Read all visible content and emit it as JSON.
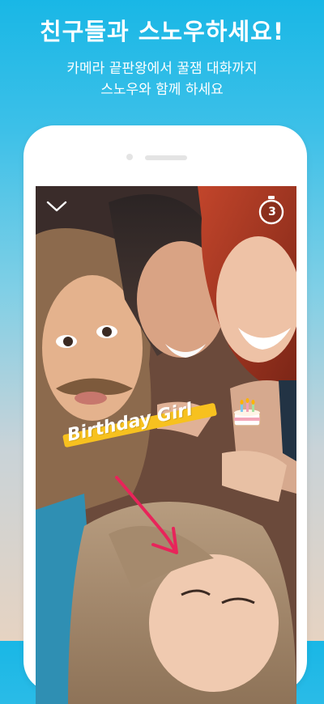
{
  "headline": "친구들과 스노우하세요!",
  "subtitle_line1": "카메라 끝판왕에서 꿀잼 대화까지",
  "subtitle_line2": "스노우와 함께 하세요",
  "screen": {
    "timer_value": "3",
    "sticker_text": "Birthday Girl",
    "icons": [
      "chevron-down-icon",
      "timer-icon",
      "birthday-cake-icon",
      "arrow-doodle-icon"
    ]
  },
  "colors": {
    "accent_blue": "#19b7e6",
    "sticker_yellow": "#f7c11f",
    "doodle_pink": "#e8245a"
  }
}
